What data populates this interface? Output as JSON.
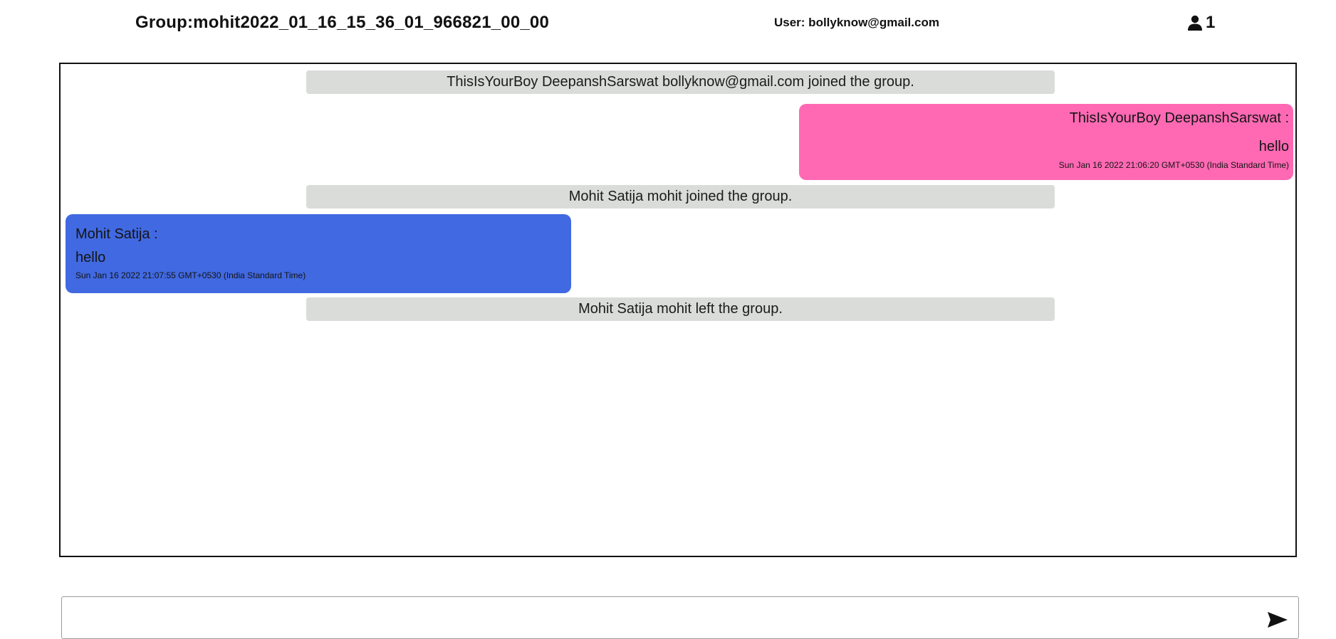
{
  "header": {
    "group_title": "Group:mohit2022_01_16_15_36_01_966821_00_00",
    "user_label": "User: bollyknow@gmail.com",
    "member_count": "1"
  },
  "messages": [
    {
      "kind": "system",
      "text": "ThisIsYourBoy DeepanshSarswat bollyknow@gmail.com joined the group."
    },
    {
      "kind": "self",
      "sender": "ThisIsYourBoy DeepanshSarswat :",
      "text": "hello",
      "timestamp": "Sun Jan 16 2022 21:06:20 GMT+0530 (India Standard Time)",
      "color": "#ff69b4"
    },
    {
      "kind": "system",
      "text": "Mohit Satija mohit joined the group."
    },
    {
      "kind": "other",
      "sender": "Mohit Satija :",
      "text": "hello",
      "timestamp": "Sun Jan 16 2022 21:07:55 GMT+0530 (India Standard Time)",
      "color": "#4169e1"
    },
    {
      "kind": "system",
      "text": "Mohit Satija mohit left the group."
    }
  ],
  "composer": {
    "value": "",
    "send_icon": "send-icon"
  },
  "colors": {
    "system_bg": "#d9dcd9",
    "self_bubble": "#ff69b4",
    "other_bubble": "#4169e1"
  }
}
